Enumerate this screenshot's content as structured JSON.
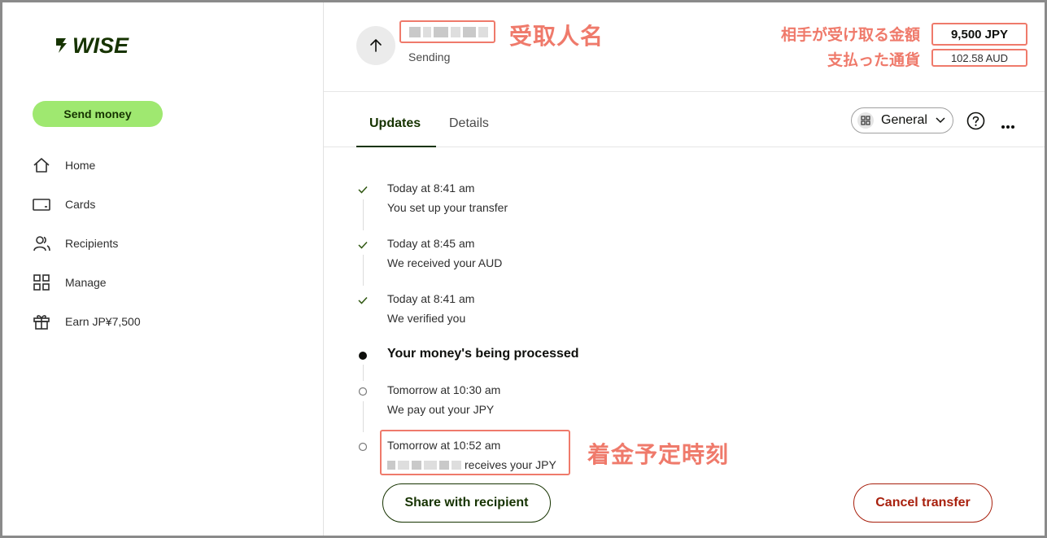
{
  "sidebar": {
    "logo_text": "WISE",
    "send_button": "Send money",
    "items": [
      {
        "label": "Home",
        "icon": "home-icon"
      },
      {
        "label": "Cards",
        "icon": "card-icon"
      },
      {
        "label": "Recipients",
        "icon": "recipients-icon"
      },
      {
        "label": "Manage",
        "icon": "grid-icon"
      },
      {
        "label": "Earn JP¥7,500",
        "icon": "gift-icon"
      }
    ]
  },
  "header": {
    "status": "Sending",
    "recipient_annotation": "受取人名",
    "received_amount_annotation": "相手が受け取る金額",
    "paid_currency_annotation": "支払った通貨",
    "received_amount": "9,500 JPY",
    "paid_amount": "102.58 AUD"
  },
  "tabs": {
    "updates": "Updates",
    "details": "Details",
    "view_select": "General"
  },
  "timeline": [
    {
      "time": "Today at 8:41 am",
      "desc": "You set up your transfer",
      "state": "done"
    },
    {
      "time": "Today at 8:45 am",
      "desc": "We received your AUD",
      "state": "done"
    },
    {
      "time": "Today at 8:41 am",
      "desc": "We verified you",
      "state": "done"
    },
    {
      "title": "Your money's being processed",
      "state": "current"
    },
    {
      "time": "Tomorrow at 10:30 am",
      "desc": "We pay out your JPY",
      "state": "pending"
    },
    {
      "time": "Tomorrow at 10:52 am",
      "desc": "receives your JPY",
      "state": "pending"
    }
  ],
  "eta_annotation": "着金予定時刻",
  "actions": {
    "share": "Share with recipient",
    "cancel": "Cancel transfer"
  },
  "colors": {
    "brand_green": "#9fe870",
    "forest": "#163300",
    "annotation": "#ef7a6b",
    "danger": "#a8200d"
  }
}
